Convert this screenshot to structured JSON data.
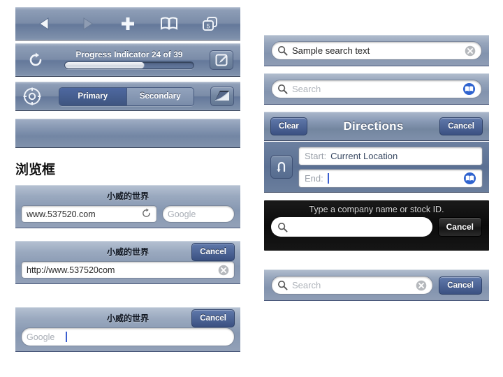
{
  "toolbar_nav": {
    "icons": [
      {
        "name": "back-arrow-icon",
        "label": "Back",
        "state": "enabled"
      },
      {
        "name": "forward-arrow-icon",
        "label": "Forward",
        "state": "disabled"
      },
      {
        "name": "plus-icon",
        "label": "Add"
      },
      {
        "name": "bookmarks-book-icon",
        "label": "Bookmarks"
      },
      {
        "name": "pages-icon",
        "label": "Pages",
        "badge": "5"
      }
    ]
  },
  "toolbar_progress": {
    "refresh_icon": "refresh-icon",
    "label": "Progress Indicator  24 of 39",
    "current": 24,
    "total": 39,
    "percent": 62,
    "compose_icon": "compose-icon"
  },
  "toolbar_segmented": {
    "locate_icon": "crosshair-locate-icon",
    "segments": [
      {
        "label": "Primary",
        "selected": true
      },
      {
        "label": "Secondary",
        "selected": false
      }
    ],
    "pagecurl_icon": "page-curl-icon"
  },
  "section": {
    "heading": "浏览框"
  },
  "browsebox_1": {
    "title": "小威的世界",
    "url_value": "www.537520.com",
    "reload_icon": "reload-icon",
    "search_placeholder": "Google"
  },
  "browsebox_2": {
    "title": "小威的世界",
    "cancel_label": "Cancel",
    "url_value": "http://www.537520com",
    "clear_icon": "clear-circle-icon"
  },
  "browsebox_3": {
    "title": "小威的世界",
    "cancel_label": "Cancel",
    "search_placeholder": "Google",
    "has_caret": true
  },
  "searchbar_filled": {
    "search_icon": "search-magnifier-icon",
    "value": "Sample search text",
    "clear_icon": "clear-circle-icon"
  },
  "searchbar_bookmark": {
    "search_icon": "search-magnifier-icon",
    "placeholder": "Search",
    "bookmark_icon": "bookmarks-book-icon"
  },
  "directions": {
    "clear_label": "Clear",
    "title": "Directions",
    "cancel_label": "Cancel",
    "swap_icon": "swap-uturn-icon",
    "start_label": "Start:",
    "start_value": "Current Location",
    "end_label": "End:",
    "end_value": "",
    "bookmark_icon": "bookmarks-book-icon"
  },
  "stock_search": {
    "hint": "Type a company name or stock ID.",
    "search_icon": "search-magnifier-icon",
    "value": "",
    "cancel_label": "Cancel"
  },
  "search_cancel": {
    "search_icon": "search-magnifier-icon",
    "placeholder": "Search",
    "clear_icon": "clear-circle-icon",
    "cancel_label": "Cancel"
  },
  "colors": {
    "bar_light": "#a7b4c8",
    "bar_dark": "#64789a",
    "accent_blue": "#2f5fd0",
    "segment_selected": "#4e68a0",
    "dark_bar": "#0b0b0b",
    "page_background": "#ffffff"
  }
}
